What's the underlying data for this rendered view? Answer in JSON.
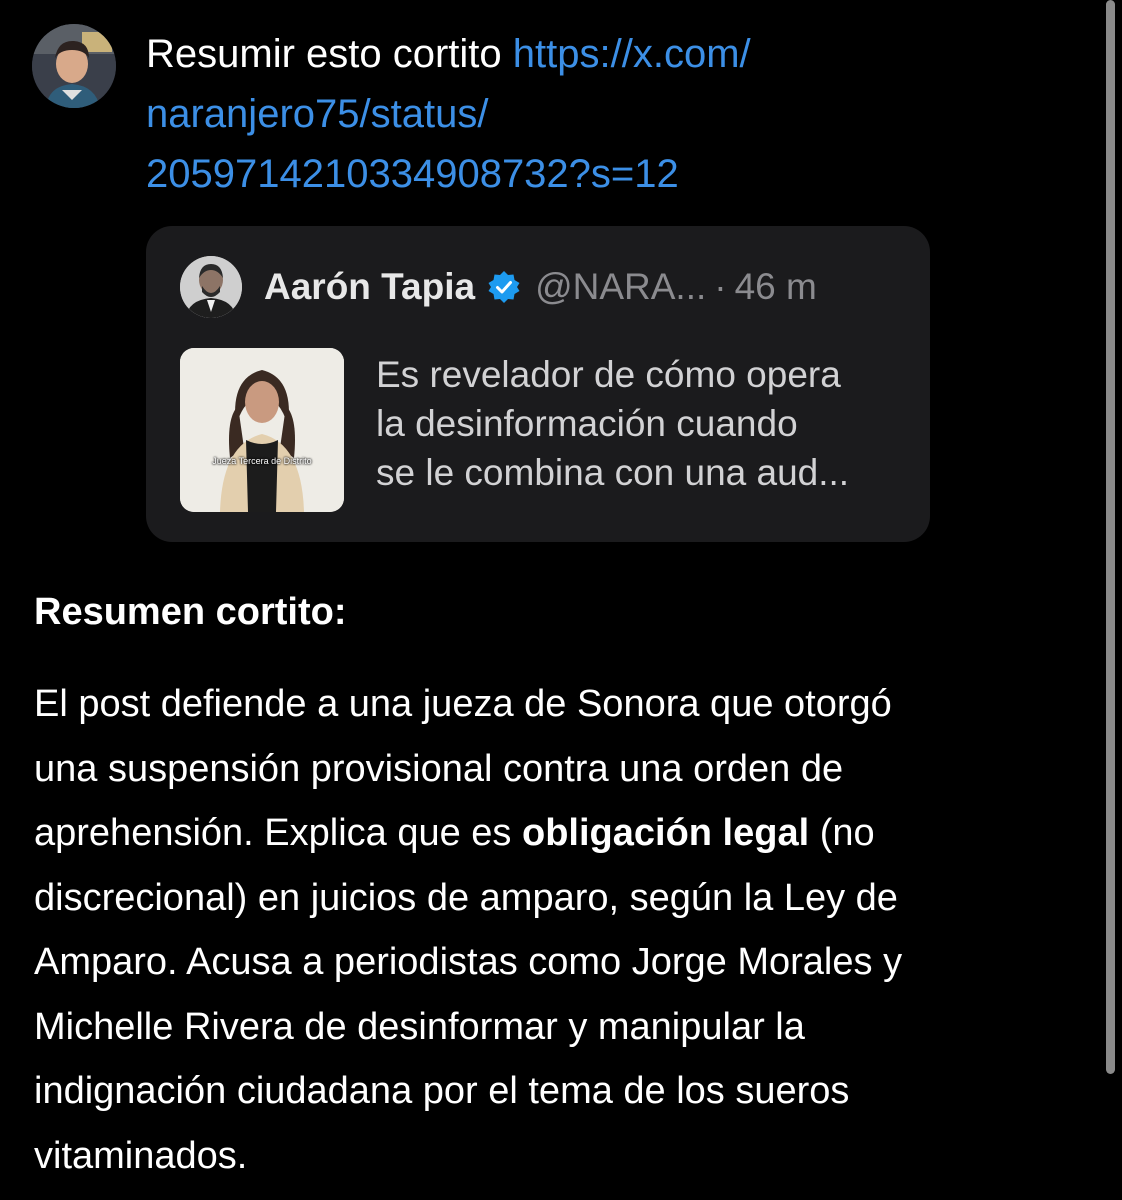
{
  "user_message": {
    "line1_text": "Resumir esto cortito ",
    "line1_link": "https://x.com/",
    "line2_link": "naranjero75/status/",
    "line3_link": "2059714210334908732?s=12",
    "link_color": "#3c8fe6"
  },
  "quoted_post": {
    "author_name": "Aarón Tapia",
    "handle": "@NARA...",
    "separator": "·",
    "time_ago": "46 m",
    "verified_color": "#1d9bf0",
    "thumbnail_caption": "Jueza Tercera de Distrito",
    "text_lines": [
      "Es revelador de cómo opera",
      "la desinformación cuando",
      "se le combina con una aud..."
    ]
  },
  "response": {
    "heading": "Resumen cortito:",
    "body": {
      "l1": "El post defiende a una jueza de Sonora que otorgó",
      "l2": "una suspensión provisional contra una orden de",
      "l3_pre": "aprehensión. Explica que es ",
      "l3_bold": "obligación legal",
      "l3_post": " (no",
      "l4": "discrecional) en juicios de amparo, según la Ley de",
      "l5": "Amparo. Acusa a periodistas como Jorge Morales y",
      "l6": "Michelle Rivera de desinformar y manipular la",
      "l7": "indignación ciudadana por el tema de los sueros",
      "l8": "vitaminados."
    }
  },
  "icons": {
    "user_avatar": "user-avatar-photo",
    "author_avatar": "author-avatar-photo",
    "verified": "verified-badge-icon"
  }
}
